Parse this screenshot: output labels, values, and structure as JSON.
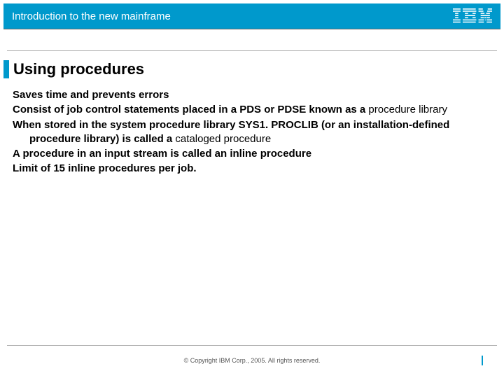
{
  "header": {
    "title": "Introduction to the new mainframe",
    "logo_name": "IBM"
  },
  "slide": {
    "title": "Using procedures",
    "bullets": [
      {
        "lead": "Saves time and prevents errors",
        "rest": ""
      },
      {
        "lead": "Consist of job control statements placed in a PDS or PDSE known as a",
        "rest": " procedure library"
      },
      {
        "lead": "When stored in the system procedure library  SYS1. PROCLIB (or an installation-defined procedure library) is called a",
        "rest": " cataloged procedure"
      },
      {
        "lead": "A procedure in an input stream is called an inline procedure",
        "rest": ""
      },
      {
        "lead": "Limit of 15 inline procedures per job.",
        "rest": ""
      }
    ]
  },
  "footer": {
    "copyright": "© Copyright IBM Corp., 2005. All rights reserved."
  },
  "colors": {
    "accent": "#0099cc"
  }
}
